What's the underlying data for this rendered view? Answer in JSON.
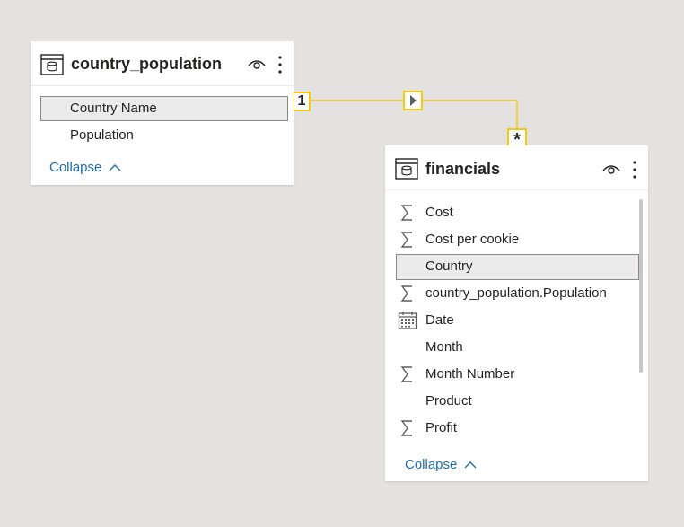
{
  "colors": {
    "canvas": "#e3e2e1",
    "card": "#ffffff",
    "relationship_line": "#f2c811",
    "link": "#1f6fa8",
    "selected_row": "#ebebeb"
  },
  "relationship": {
    "from_cardinality": "1",
    "to_cardinality": "*",
    "filter_direction_icon": "arrow-right-icon"
  },
  "tables": [
    {
      "title": "country_population",
      "icon": "table-icon",
      "visibility_icon": "eye-icon",
      "more_icon": "more-vertical-icon",
      "fields": [
        {
          "label": "Country Name",
          "icon": "",
          "selected": true
        },
        {
          "label": "Population",
          "icon": "",
          "selected": false
        }
      ],
      "collapse_label": "Collapse"
    },
    {
      "title": "financials",
      "icon": "table-icon",
      "visibility_icon": "eye-icon",
      "more_icon": "more-vertical-icon",
      "fields": [
        {
          "label": "Cost",
          "icon": "sigma-icon",
          "selected": false
        },
        {
          "label": "Cost per cookie",
          "icon": "sigma-icon",
          "selected": false
        },
        {
          "label": "Country",
          "icon": "",
          "selected": true
        },
        {
          "label": "country_population.Population",
          "icon": "sigma-icon",
          "selected": false
        },
        {
          "label": "Date",
          "icon": "calendar-icon",
          "selected": false
        },
        {
          "label": "Month",
          "icon": "",
          "selected": false
        },
        {
          "label": "Month Number",
          "icon": "sigma-icon",
          "selected": false
        },
        {
          "label": "Product",
          "icon": "",
          "selected": false
        },
        {
          "label": "Profit",
          "icon": "sigma-icon",
          "selected": false
        }
      ],
      "collapse_label": "Collapse"
    }
  ]
}
